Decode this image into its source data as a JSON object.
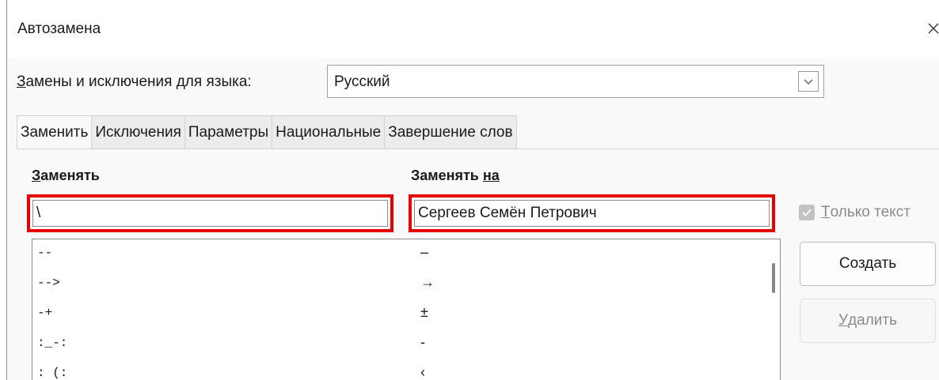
{
  "window": {
    "title": "Автозамена"
  },
  "language": {
    "label_underlined": "З",
    "label_rest": "амены и исключения для языка:",
    "selected": "Русский"
  },
  "tabs": [
    {
      "label": "Заменить",
      "active": true
    },
    {
      "label": "Исключения",
      "active": false
    },
    {
      "label": "Параметры",
      "active": false
    },
    {
      "label": "Национальные",
      "active": false
    },
    {
      "label": "Завершение слов",
      "active": false
    }
  ],
  "columns": {
    "replace_underlined": "З",
    "replace_rest": "аменять",
    "with_prefix": "Заменять ",
    "with_underlined": "на"
  },
  "inputs": {
    "replace_value": "\\",
    "with_value": "Сергеев Семён Петрович"
  },
  "only_text": {
    "underlined": "Т",
    "rest": "олько текст",
    "checked": true
  },
  "rows": [
    {
      "from": "--",
      "to": "–"
    },
    {
      "from": "-->",
      "to": "→"
    },
    {
      "from": "-+",
      "to": "±"
    },
    {
      "from": ":_-:",
      "to": "-"
    },
    {
      "from": ": (:",
      "to": "‹"
    }
  ],
  "buttons": {
    "create": "Создать",
    "delete_underlined": "У",
    "delete_rest": "далить"
  },
  "colors": {
    "highlight": "#e60000"
  }
}
